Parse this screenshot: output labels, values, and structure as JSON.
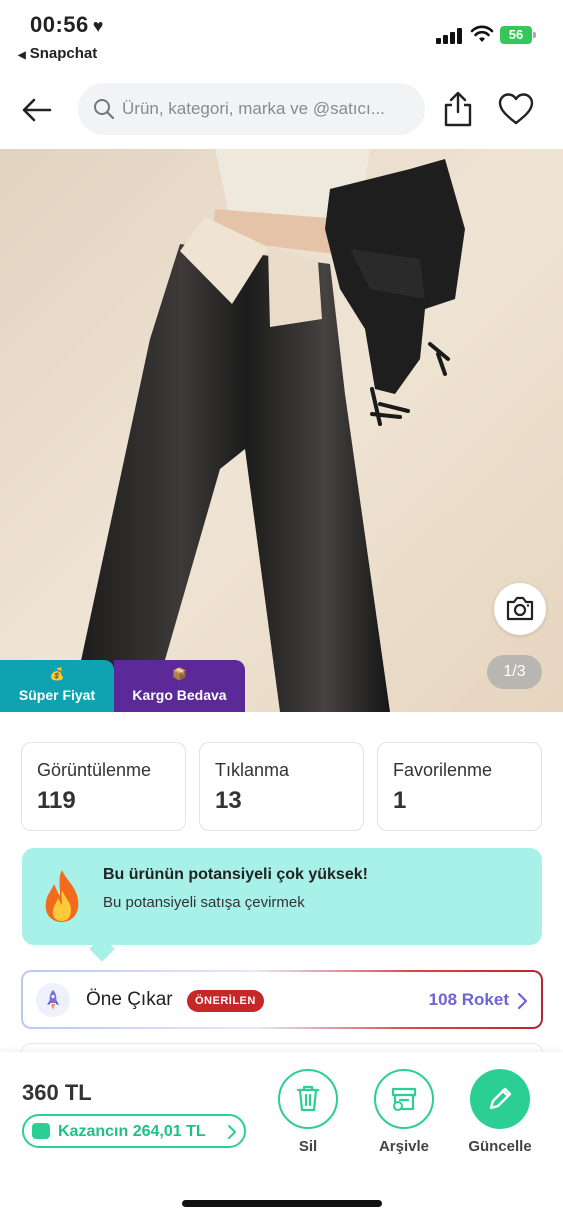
{
  "status_bar": {
    "time": "00:56",
    "heart": "♥",
    "back_app": "Snapchat",
    "back_glyph": "◀",
    "battery": "56"
  },
  "header": {
    "search_placeholder": "Ürün, kategori, marka ve @satıcı...",
    "icons": [
      "back-arrow-icon",
      "search-icon",
      "share-icon",
      "heart-icon"
    ]
  },
  "product": {
    "image_counter": "1/3",
    "badges": [
      {
        "label": "Süper Fiyat",
        "icon": "💰",
        "color": "#0fa3b1"
      },
      {
        "label": "Kargo Bedava",
        "icon": "📦",
        "color": "#5b2a98"
      }
    ]
  },
  "stats": [
    {
      "label": "Görüntülenme",
      "value": "119"
    },
    {
      "label": "Tıklanma",
      "value": "13"
    },
    {
      "label": "Favorilenme",
      "value": "1"
    }
  ],
  "promo": {
    "title": "Bu ürünün potansiyeli çok yüksek!",
    "subtitle": "Bu potansiyeli satışa çevirmek"
  },
  "one_cikar": {
    "label": "Öne Çıkar",
    "badge": "ÖNERİLEN",
    "roket": "108 Roket"
  },
  "bottom": {
    "price": "360 TL",
    "earning": "Kazancın 264,01 TL",
    "actions": [
      {
        "label": "Sil"
      },
      {
        "label": "Arşivle"
      },
      {
        "label": "Güncelle"
      }
    ]
  },
  "colors": {
    "accent_green": "#2ccf93",
    "promo_bg": "#a8f1e8",
    "roket_purple": "#6d63d6",
    "badge_red": "#c62828"
  }
}
